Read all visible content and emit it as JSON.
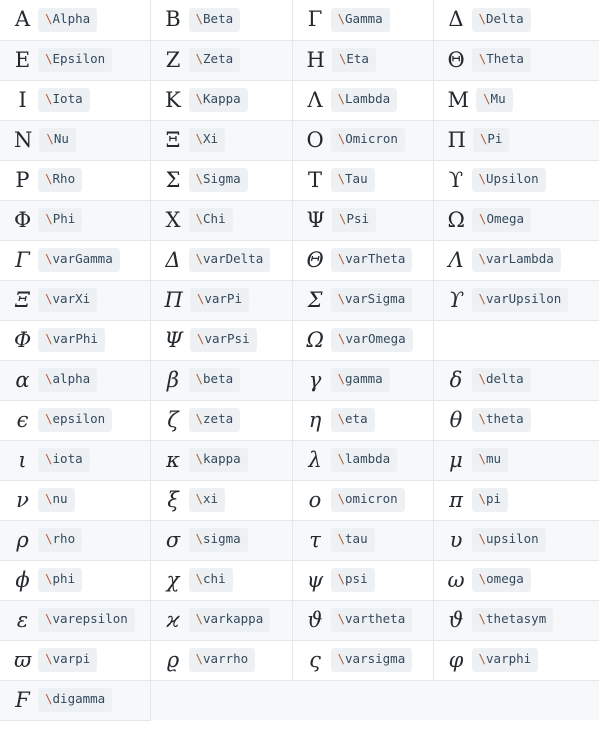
{
  "page": {
    "title": "Greek Letters LaTeX Reference",
    "type": "symbol-reference-table",
    "columns": 4,
    "rows": 18,
    "colors": {
      "row_even_background": "#f6f8fa",
      "row_odd_background": "#ffffff",
      "border": "#e4e8ec",
      "code_background": "#eef1f4",
      "code_text": "#34495e",
      "backslash_accent": "#b5603a",
      "glyph_text": "#24292e"
    }
  },
  "table": {
    "rows": [
      [
        {
          "glyph": "Α",
          "italic": false,
          "bs": "\\",
          "cmd": "Alpha"
        },
        {
          "glyph": "Β",
          "italic": false,
          "bs": "\\",
          "cmd": "Beta"
        },
        {
          "glyph": "Γ",
          "italic": false,
          "bs": "\\",
          "cmd": "Gamma"
        },
        {
          "glyph": "Δ",
          "italic": false,
          "bs": "\\",
          "cmd": "Delta"
        }
      ],
      [
        {
          "glyph": "Ε",
          "italic": false,
          "bs": "\\",
          "cmd": "Epsilon"
        },
        {
          "glyph": "Ζ",
          "italic": false,
          "bs": "\\",
          "cmd": "Zeta"
        },
        {
          "glyph": "Η",
          "italic": false,
          "bs": "\\",
          "cmd": "Eta"
        },
        {
          "glyph": "Θ",
          "italic": false,
          "bs": "\\",
          "cmd": "Theta"
        }
      ],
      [
        {
          "glyph": "Ι",
          "italic": false,
          "bs": "\\",
          "cmd": "Iota"
        },
        {
          "glyph": "Κ",
          "italic": false,
          "bs": "\\",
          "cmd": "Kappa"
        },
        {
          "glyph": "Λ",
          "italic": false,
          "bs": "\\",
          "cmd": "Lambda"
        },
        {
          "glyph": "Μ",
          "italic": false,
          "bs": "\\",
          "cmd": "Mu"
        }
      ],
      [
        {
          "glyph": "Ν",
          "italic": false,
          "bs": "\\",
          "cmd": "Nu"
        },
        {
          "glyph": "Ξ",
          "italic": false,
          "bs": "\\",
          "cmd": "Xi"
        },
        {
          "glyph": "Ο",
          "italic": false,
          "bs": "\\",
          "cmd": "Omicron"
        },
        {
          "glyph": "Π",
          "italic": false,
          "bs": "\\",
          "cmd": "Pi"
        }
      ],
      [
        {
          "glyph": "Ρ",
          "italic": false,
          "bs": "\\",
          "cmd": "Rho"
        },
        {
          "glyph": "Σ",
          "italic": false,
          "bs": "\\",
          "cmd": "Sigma"
        },
        {
          "glyph": "Τ",
          "italic": false,
          "bs": "\\",
          "cmd": "Tau"
        },
        {
          "glyph": "ϒ",
          "italic": false,
          "bs": "\\",
          "cmd": "Upsilon"
        }
      ],
      [
        {
          "glyph": "Φ",
          "italic": false,
          "bs": "\\",
          "cmd": "Phi"
        },
        {
          "glyph": "Χ",
          "italic": false,
          "bs": "\\",
          "cmd": "Chi"
        },
        {
          "glyph": "Ψ",
          "italic": false,
          "bs": "\\",
          "cmd": "Psi"
        },
        {
          "glyph": "Ω",
          "italic": false,
          "bs": "\\",
          "cmd": "Omega"
        }
      ],
      [
        {
          "glyph": "Γ",
          "italic": true,
          "bs": "\\",
          "cmd": "varGamma"
        },
        {
          "glyph": "Δ",
          "italic": true,
          "bs": "\\",
          "cmd": "varDelta"
        },
        {
          "glyph": "Θ",
          "italic": true,
          "bs": "\\",
          "cmd": "varTheta"
        },
        {
          "glyph": "Λ",
          "italic": true,
          "bs": "\\",
          "cmd": "varLambda"
        }
      ],
      [
        {
          "glyph": "Ξ",
          "italic": true,
          "bs": "\\",
          "cmd": "varXi"
        },
        {
          "glyph": "Π",
          "italic": true,
          "bs": "\\",
          "cmd": "varPi"
        },
        {
          "glyph": "Σ",
          "italic": true,
          "bs": "\\",
          "cmd": "varSigma"
        },
        {
          "glyph": "ϒ",
          "italic": true,
          "bs": "\\",
          "cmd": "varUpsilon"
        }
      ],
      [
        {
          "glyph": "Φ",
          "italic": true,
          "bs": "\\",
          "cmd": "varPhi"
        },
        {
          "glyph": "Ψ",
          "italic": true,
          "bs": "\\",
          "cmd": "varPsi"
        },
        {
          "glyph": "Ω",
          "italic": true,
          "bs": "\\",
          "cmd": "varOmega"
        },
        null
      ],
      [
        {
          "glyph": "α",
          "italic": true,
          "bs": "\\",
          "cmd": "alpha"
        },
        {
          "glyph": "β",
          "italic": true,
          "bs": "\\",
          "cmd": "beta"
        },
        {
          "glyph": "γ",
          "italic": true,
          "bs": "\\",
          "cmd": "gamma"
        },
        {
          "glyph": "δ",
          "italic": true,
          "bs": "\\",
          "cmd": "delta"
        }
      ],
      [
        {
          "glyph": "ϵ",
          "italic": true,
          "bs": "\\",
          "cmd": "epsilon"
        },
        {
          "glyph": "ζ",
          "italic": true,
          "bs": "\\",
          "cmd": "zeta"
        },
        {
          "glyph": "η",
          "italic": true,
          "bs": "\\",
          "cmd": "eta"
        },
        {
          "glyph": "θ",
          "italic": true,
          "bs": "\\",
          "cmd": "theta"
        }
      ],
      [
        {
          "glyph": "ι",
          "italic": true,
          "bs": "\\",
          "cmd": "iota"
        },
        {
          "glyph": "κ",
          "italic": true,
          "bs": "\\",
          "cmd": "kappa"
        },
        {
          "glyph": "λ",
          "italic": true,
          "bs": "\\",
          "cmd": "lambda"
        },
        {
          "glyph": "μ",
          "italic": true,
          "bs": "\\",
          "cmd": "mu"
        }
      ],
      [
        {
          "glyph": "ν",
          "italic": true,
          "bs": "\\",
          "cmd": "nu"
        },
        {
          "glyph": "ξ",
          "italic": true,
          "bs": "\\",
          "cmd": "xi"
        },
        {
          "glyph": "ο",
          "italic": true,
          "bs": "\\",
          "cmd": "omicron"
        },
        {
          "glyph": "π",
          "italic": true,
          "bs": "\\",
          "cmd": "pi"
        }
      ],
      [
        {
          "glyph": "ρ",
          "italic": true,
          "bs": "\\",
          "cmd": "rho"
        },
        {
          "glyph": "σ",
          "italic": true,
          "bs": "\\",
          "cmd": "sigma"
        },
        {
          "glyph": "τ",
          "italic": true,
          "bs": "\\",
          "cmd": "tau"
        },
        {
          "glyph": "υ",
          "italic": true,
          "bs": "\\",
          "cmd": "upsilon"
        }
      ],
      [
        {
          "glyph": "ϕ",
          "italic": true,
          "bs": "\\",
          "cmd": "phi"
        },
        {
          "glyph": "χ",
          "italic": true,
          "bs": "\\",
          "cmd": "chi"
        },
        {
          "glyph": "ψ",
          "italic": true,
          "bs": "\\",
          "cmd": "psi"
        },
        {
          "glyph": "ω",
          "italic": true,
          "bs": "\\",
          "cmd": "omega"
        }
      ],
      [
        {
          "glyph": "ε",
          "italic": true,
          "bs": "\\",
          "cmd": "varepsilon"
        },
        {
          "glyph": "ϰ",
          "italic": true,
          "bs": "\\",
          "cmd": "varkappa"
        },
        {
          "glyph": "ϑ",
          "italic": true,
          "bs": "\\",
          "cmd": "vartheta"
        },
        {
          "glyph": "ϑ",
          "italic": true,
          "bs": "\\",
          "cmd": "thetasym"
        }
      ],
      [
        {
          "glyph": "ϖ",
          "italic": true,
          "bs": "\\",
          "cmd": "varpi"
        },
        {
          "glyph": "ϱ",
          "italic": true,
          "bs": "\\",
          "cmd": "varrho"
        },
        {
          "glyph": "ς",
          "italic": true,
          "bs": "\\",
          "cmd": "varsigma"
        },
        {
          "glyph": "φ",
          "italic": true,
          "bs": "\\",
          "cmd": "varphi"
        }
      ],
      [
        {
          "glyph": "Ϝ",
          "italic": true,
          "bs": "\\",
          "cmd": "digamma"
        },
        null,
        null,
        null
      ]
    ]
  }
}
